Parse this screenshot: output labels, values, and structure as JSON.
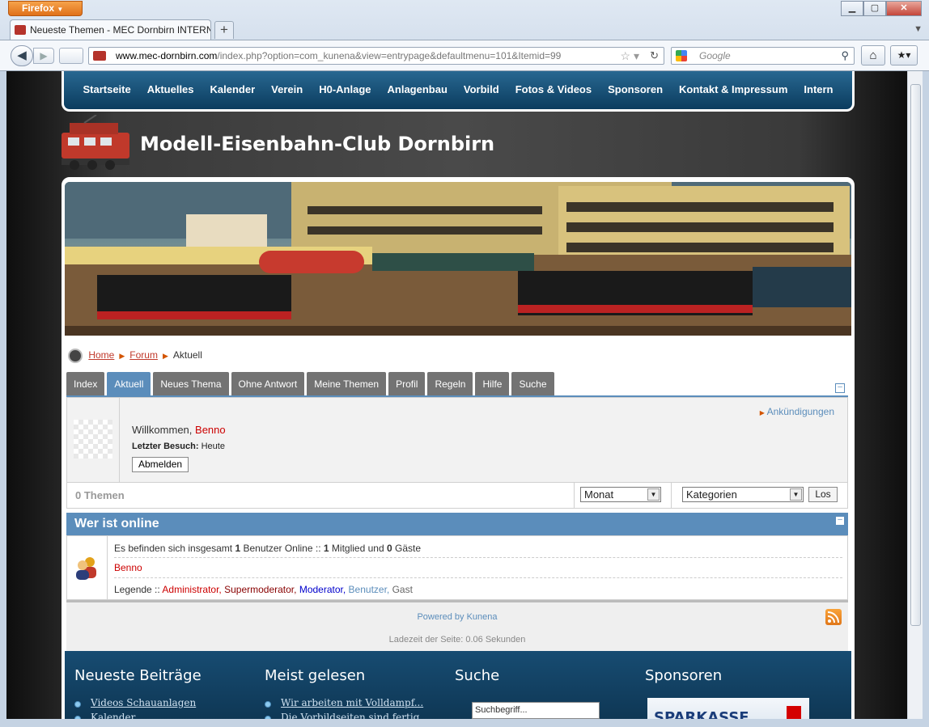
{
  "browser": {
    "menu_button": "Firefox",
    "tab_title": "Neueste Themen - MEC Dornbirn INTERN",
    "url_host": "www.mec-dornbirn.com",
    "url_rest": "/index.php?option=com_kunena&view=entrypage&defaultmenu=101&Itemid=99",
    "search_placeholder": "Google"
  },
  "site": {
    "nav": [
      "Startseite",
      "Aktuelles",
      "Kalender",
      "Verein",
      "H0-Anlage",
      "Anlagenbau",
      "Vorbild",
      "Fotos & Videos",
      "Sponsoren",
      "Kontakt & Impressum",
      "Intern"
    ],
    "title": "Modell-Eisenbahn-Club Dornbirn"
  },
  "breadcrumb": {
    "home": "Home",
    "forum": "Forum",
    "current": "Aktuell"
  },
  "forum_tabs": [
    "Index",
    "Aktuell",
    "Neues Thema",
    "Ohne Antwort",
    "Meine Themen",
    "Profil",
    "Regeln",
    "Hilfe",
    "Suche"
  ],
  "active_tab": "Aktuell",
  "profile": {
    "welcome": "Willkommen,",
    "username": "Benno",
    "last_visit_label": "Letzter Besuch:",
    "last_visit_value": "Heute",
    "logout": "Abmelden",
    "announcements": "Ankündigungen"
  },
  "threads": {
    "count_label": "0 Themen",
    "period_select": "Monat",
    "category_select": "Kategorien",
    "go_button": "Los"
  },
  "online": {
    "title": "Wer ist online",
    "line_prefix": "Es befinden sich insgesamt",
    "total_users": "1",
    "users_online_text": "Benutzer Online  ::",
    "members": "1",
    "members_text": "Mitglied und",
    "guests": "0",
    "guests_text": "Gäste",
    "user": "Benno",
    "legend_label": "Legende ::",
    "legend": {
      "admin": "Administrator,",
      "supermod": "Supermoderator,",
      "mod": "Moderator,",
      "user": "Benutzer,",
      "guest": "Gast"
    }
  },
  "footer": {
    "powered": "Powered by Kunena",
    "load_time": "Ladezeit der Seite: 0.06 Sekunden",
    "col1_title": "Neueste Beiträge",
    "col1_links": [
      "Videos Schauanlagen",
      "Kalender"
    ],
    "col2_title": "Meist gelesen",
    "col2_links": [
      "Wir arbeiten mit Volldampf...",
      "Die Vorbildseiten sind fertig"
    ],
    "col3_title": "Suche",
    "search_value": "Suchbegriff...",
    "col4_title": "Sponsoren",
    "sponsor": "SPARKASSE"
  }
}
